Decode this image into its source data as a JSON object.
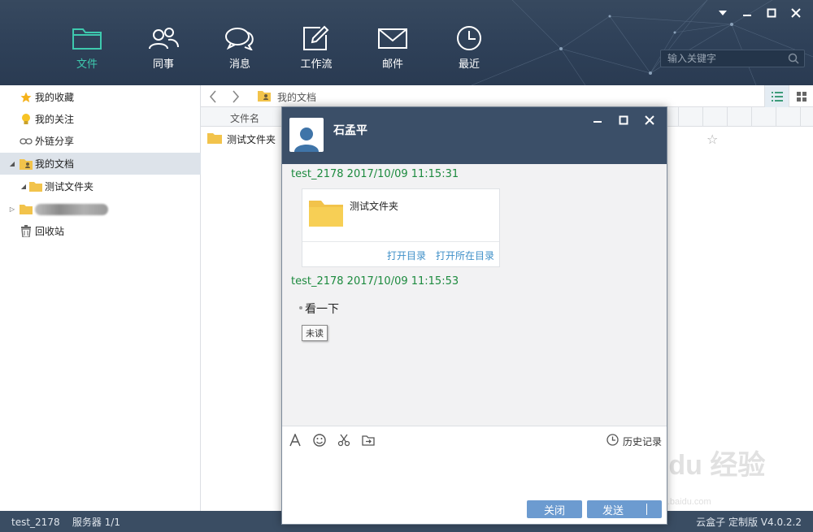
{
  "window": {
    "min_icon": "minimize-icon",
    "max_icon": "maximize-icon",
    "close_icon": "close-icon",
    "menu_icon": "dropdown-triangle-icon"
  },
  "nav": {
    "items": [
      {
        "label": "文件",
        "icon": "folder-icon",
        "active": true
      },
      {
        "label": "同事",
        "icon": "colleagues-icon",
        "active": false
      },
      {
        "label": "消息",
        "icon": "chat-bubbles-icon",
        "active": false
      },
      {
        "label": "工作流",
        "icon": "edit-icon",
        "active": false
      },
      {
        "label": "邮件",
        "icon": "mail-icon",
        "active": false
      },
      {
        "label": "最近",
        "icon": "clock-icon",
        "active": false
      }
    ],
    "active_color": "#3ec9ae"
  },
  "search": {
    "placeholder": "输入关键字"
  },
  "sidebar": {
    "items": [
      {
        "label": "我的收藏",
        "icon": "star-icon"
      },
      {
        "label": "我的关注",
        "icon": "bulb-icon"
      },
      {
        "label": "外链分享",
        "icon": "link-icon"
      },
      {
        "label": "我的文档",
        "icon": "user-folder-icon"
      },
      {
        "label": "测试文件夹",
        "icon": "folder-icon"
      },
      {
        "label": "",
        "icon": "folder-icon"
      },
      {
        "label": "回收站",
        "icon": "trash-icon"
      }
    ]
  },
  "pathbar": {
    "path": "我的文档"
  },
  "columns": {
    "name": "文件名"
  },
  "files": [
    {
      "name": "测试文件夹"
    }
  ],
  "chat": {
    "contact": "石孟平",
    "messages": [
      {
        "meta": "test_2178  2017/10/09 11:15:31"
      },
      {
        "meta": "test_2178  2017/10/09 11:15:53",
        "text": "看一下",
        "status": "未读"
      }
    ],
    "file_card": {
      "name": "测试文件夹",
      "open": "打开目录",
      "open_location": "打开所在目录"
    },
    "history": "历史记录",
    "close_label": "关闭",
    "send_label": "发送"
  },
  "status": {
    "user": "test_2178",
    "server": "服务器 1/1",
    "version": "云盒子 定制版 V4.0.2.2"
  },
  "watermark": {
    "text": "Bai du 经验",
    "url": "jingyan.baidu.com"
  }
}
